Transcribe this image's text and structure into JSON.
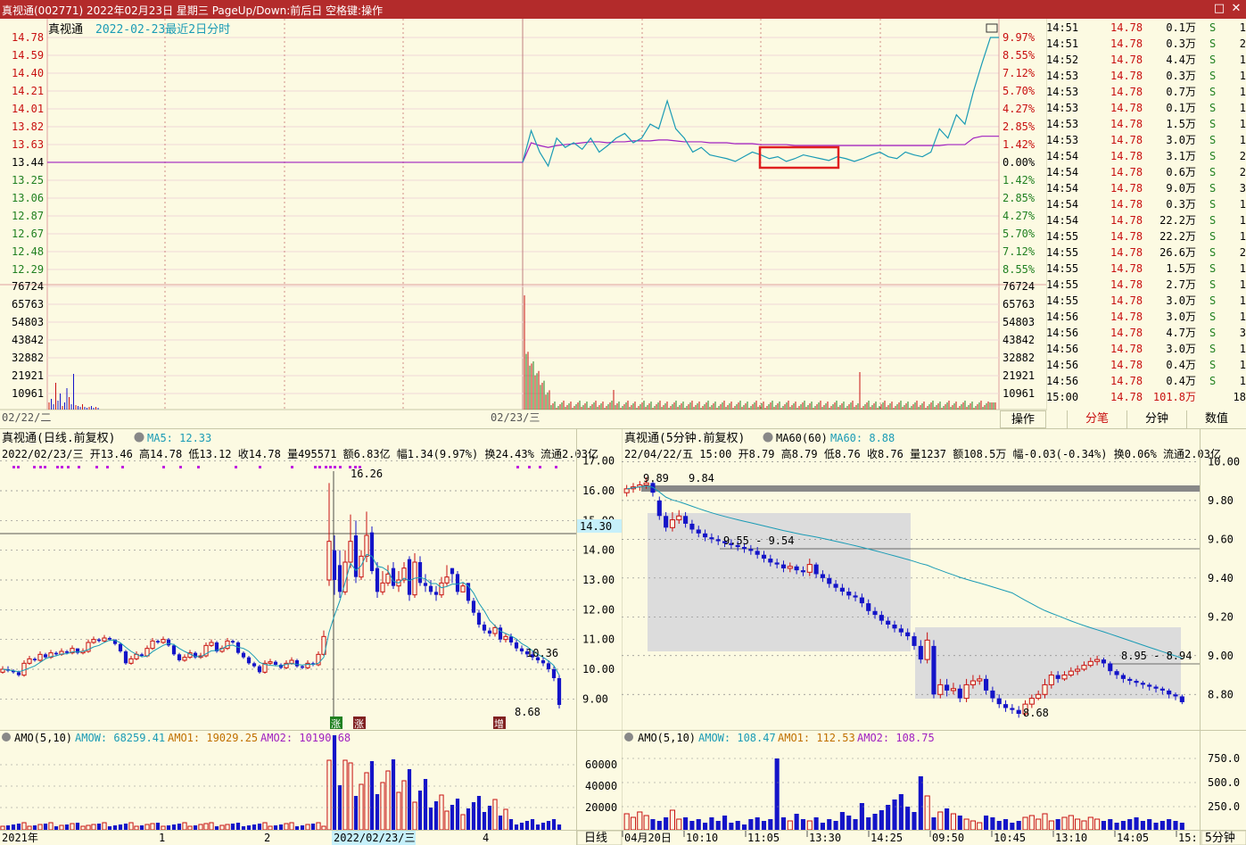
{
  "window": {
    "title": "真视通(002771) 2022年02月23日 星期三 PageUp/Down:前后日 空格键:操作",
    "minimize_icon": "restore-icon",
    "close_icon": "close-icon"
  },
  "colors": {
    "bg": "#fcfae2",
    "grid": "#e8b8b8",
    "up": "#c81010",
    "down": "#1414c8",
    "price_line": "#1a9bb5",
    "avg_line": "#a020c0"
  },
  "intraday": {
    "name": "真视通",
    "date_label": "2022-02-23最近2日分时",
    "price_ticks": [
      "14.78",
      "14.59",
      "14.40",
      "14.21",
      "14.01",
      "13.82",
      "13.63",
      "13.44",
      "13.25",
      "13.06",
      "12.87",
      "12.67",
      "12.48",
      "12.29"
    ],
    "pct_ticks": [
      "9.97%",
      "8.55%",
      "7.12%",
      "5.70%",
      "4.27%",
      "2.85%",
      "1.42%",
      "0.00%",
      "1.42%",
      "2.85%",
      "4.27%",
      "5.70%",
      "7.12%",
      "8.55%"
    ],
    "vol_ticks": [
      "76724",
      "65763",
      "54803",
      "43842",
      "32882",
      "21921",
      "10961"
    ],
    "day_labels": [
      "02/22/二",
      "02/23/三"
    ],
    "prev_close": 13.44,
    "chart_data": {
      "type": "line",
      "series": [
        {
          "values": [
            13.44,
            13.78,
            13.55,
            13.4,
            13.7,
            13.6,
            13.65,
            13.58,
            13.7,
            13.55,
            13.62,
            13.7,
            13.75,
            13.65,
            13.7,
            13.85,
            13.8,
            14.1,
            13.8,
            13.7,
            13.55,
            13.6,
            13.52,
            13.5,
            13.48,
            13.45,
            13.5,
            13.55,
            13.52,
            13.48,
            13.5,
            13.45,
            13.48,
            13.52,
            13.5,
            13.48,
            13.46,
            13.5,
            13.48,
            13.45,
            13.48,
            13.52,
            13.55,
            13.5,
            13.48,
            13.55,
            13.52,
            13.5,
            13.55,
            13.8,
            13.7,
            13.95,
            13.85,
            14.2,
            14.5,
            14.78,
            14.78
          ]
        },
        {
          "values": [
            13.44,
            13.65,
            13.62,
            13.6,
            13.62,
            13.63,
            13.64,
            13.65,
            13.66,
            13.66,
            13.65,
            13.66,
            13.66,
            13.67,
            13.67,
            13.67,
            13.68,
            13.68,
            13.67,
            13.66,
            13.66,
            13.66,
            13.65,
            13.65,
            13.65,
            13.64,
            13.64,
            13.64,
            13.63,
            13.63,
            13.63,
            13.63,
            13.62,
            13.62,
            13.62,
            13.62,
            13.62,
            13.62,
            13.62,
            13.62,
            13.62,
            13.62,
            13.62,
            13.62,
            13.62,
            13.62,
            13.62,
            13.62,
            13.62,
            13.62,
            13.63,
            13.63,
            13.63,
            13.7,
            13.72,
            13.72,
            13.72
          ]
        }
      ]
    }
  },
  "tick_list": {
    "rows": [
      [
        "14:51",
        "14.78",
        "0.1万",
        "S",
        "1"
      ],
      [
        "14:51",
        "14.78",
        "0.3万",
        "S",
        "2"
      ],
      [
        "14:52",
        "14.78",
        "4.4万",
        "S",
        "1"
      ],
      [
        "14:53",
        "14.78",
        "0.3万",
        "S",
        "1"
      ],
      [
        "14:53",
        "14.78",
        "0.7万",
        "S",
        "1"
      ],
      [
        "14:53",
        "14.78",
        "0.1万",
        "S",
        "1"
      ],
      [
        "14:53",
        "14.78",
        "1.5万",
        "S",
        "1"
      ],
      [
        "14:53",
        "14.78",
        "3.0万",
        "S",
        "1"
      ],
      [
        "14:54",
        "14.78",
        "3.1万",
        "S",
        "2"
      ],
      [
        "14:54",
        "14.78",
        "0.6万",
        "S",
        "2"
      ],
      [
        "14:54",
        "14.78",
        "9.0万",
        "S",
        "3"
      ],
      [
        "14:54",
        "14.78",
        "0.3万",
        "S",
        "1"
      ],
      [
        "14:54",
        "14.78",
        "22.2万",
        "S",
        "1"
      ],
      [
        "14:55",
        "14.78",
        "22.2万",
        "S",
        "1"
      ],
      [
        "14:55",
        "14.78",
        "26.6万",
        "S",
        "2"
      ],
      [
        "14:55",
        "14.78",
        "1.5万",
        "S",
        "1"
      ],
      [
        "14:55",
        "14.78",
        "2.7万",
        "S",
        "1"
      ],
      [
        "14:55",
        "14.78",
        "3.0万",
        "S",
        "1"
      ],
      [
        "14:56",
        "14.78",
        "3.0万",
        "S",
        "1"
      ],
      [
        "14:56",
        "14.78",
        "4.7万",
        "S",
        "3"
      ],
      [
        "14:56",
        "14.78",
        "3.0万",
        "S",
        "1"
      ],
      [
        "14:56",
        "14.78",
        "0.4万",
        "S",
        "1"
      ],
      [
        "14:56",
        "14.78",
        "0.4万",
        "S",
        "1"
      ],
      [
        "15:00",
        "14.78",
        "101.8万",
        "",
        "18"
      ]
    ],
    "operate_label": "操作",
    "tabs": [
      "分笔",
      "分钟",
      "数值"
    ]
  },
  "daily": {
    "header": "真视通(日线.前复权)",
    "ma_label": "MA5: 12.33",
    "info": "2022/02/23/三 开13.46 高14.78 低13.12 收14.78 量495571 额6.83亿 幅1.34(9.97%) 换24.43% 流通2.03亿",
    "axis_ticks": [
      "17.00",
      "16.00",
      "15.00",
      "14.00",
      "13.00",
      "12.00",
      "11.00",
      "10.00",
      "9.00"
    ],
    "cursor_value": "14.30",
    "annotations": {
      "high": "16.26",
      "mid": "10.36",
      "low": "8.68"
    },
    "markers": [
      "涨",
      "涨",
      "增"
    ],
    "amo_label": "AMO(5,10)",
    "amo_values": [
      "AMOW: 68259.41",
      "AMO1: 19029.25",
      "AMO2: 10190.68"
    ],
    "amo_ticks": [
      "60000",
      "40000",
      "20000"
    ],
    "x_labels": [
      "2021年",
      "1",
      "2",
      "2022/02/23/三",
      "4"
    ],
    "period_tab": "日线",
    "chart_data": {
      "type": "candlestick",
      "y_axis_range": [
        8.5,
        17.5
      ],
      "close": [
        10.0,
        9.95,
        9.9,
        9.8,
        10.2,
        10.35,
        10.3,
        10.5,
        10.4,
        10.55,
        10.5,
        10.6,
        10.55,
        10.7,
        10.55,
        10.6,
        10.9,
        11.0,
        10.95,
        11.05,
        11.0,
        10.85,
        10.6,
        10.2,
        10.35,
        10.5,
        10.45,
        10.7,
        10.95,
        10.9,
        11.0,
        10.8,
        10.5,
        10.3,
        10.4,
        10.55,
        10.4,
        10.45,
        10.8,
        10.9,
        10.6,
        10.7,
        10.95,
        10.9,
        10.55,
        10.4,
        10.2,
        10.1,
        9.9,
        10.2,
        10.25,
        10.15,
        10.05,
        10.2,
        10.3,
        10.1,
        10.05,
        10.2,
        10.15,
        10.5,
        11.1,
        14.3,
        13.0,
        12.6,
        13.6,
        14.3,
        13.1,
        13.8,
        14.5,
        13.3,
        12.6,
        12.9,
        13.2,
        12.8,
        13.0,
        13.4,
        12.5,
        13.6,
        12.9,
        12.8,
        12.6,
        12.5,
        12.9,
        13.1,
        13.2,
        12.6,
        12.8,
        12.3,
        11.9,
        11.5,
        11.3,
        11.2,
        11.4,
        11.0,
        11.1,
        10.9,
        10.7,
        10.6,
        10.5,
        10.4,
        10.3,
        10.2,
        10.0,
        9.7,
        8.8
      ],
      "open": [
        9.9,
        10.0,
        9.95,
        9.9,
        9.8,
        10.2,
        10.35,
        10.3,
        10.5,
        10.4,
        10.55,
        10.5,
        10.6,
        10.55,
        10.7,
        10.55,
        10.6,
        10.9,
        11.0,
        10.95,
        11.05,
        11.0,
        10.85,
        10.6,
        10.2,
        10.35,
        10.5,
        10.45,
        10.7,
        10.95,
        10.9,
        11.0,
        10.8,
        10.5,
        10.3,
        10.4,
        10.55,
        10.4,
        10.45,
        10.8,
        10.9,
        10.6,
        10.7,
        10.95,
        10.9,
        10.55,
        10.4,
        10.2,
        10.1,
        9.9,
        10.2,
        10.25,
        10.15,
        10.05,
        10.2,
        10.3,
        10.1,
        10.05,
        10.2,
        10.15,
        10.5,
        13.0,
        14.0,
        13.5,
        12.6,
        13.6,
        14.5,
        13.1,
        13.8,
        14.6,
        13.4,
        12.6,
        12.9,
        13.4,
        12.8,
        13.0,
        13.7,
        12.5,
        13.6,
        12.9,
        12.8,
        12.6,
        12.5,
        12.9,
        13.4,
        13.2,
        12.6,
        12.9,
        12.3,
        11.9,
        11.5,
        11.3,
        11.2,
        11.4,
        11.0,
        11.1,
        10.9,
        10.7,
        10.6,
        10.5,
        10.4,
        10.3,
        10.2,
        10.0,
        9.7
      ],
      "high": [
        10.1,
        10.1,
        10.0,
        9.95,
        10.3,
        10.45,
        10.4,
        10.6,
        10.55,
        10.65,
        10.6,
        10.7,
        10.65,
        10.8,
        10.7,
        10.7,
        11.0,
        11.1,
        11.05,
        11.15,
        11.1,
        11.0,
        10.9,
        10.65,
        10.45,
        10.6,
        10.55,
        10.8,
        11.05,
        11.0,
        11.1,
        11.05,
        10.85,
        10.55,
        10.5,
        10.65,
        10.6,
        10.55,
        10.9,
        11.0,
        10.95,
        10.8,
        11.05,
        11.0,
        10.95,
        10.6,
        10.45,
        10.25,
        10.15,
        10.3,
        10.35,
        10.3,
        10.2,
        10.3,
        10.4,
        10.35,
        10.15,
        10.3,
        10.25,
        10.6,
        11.3,
        16.26,
        14.5,
        14.0,
        14.0,
        15.2,
        15.0,
        14.0,
        15.3,
        14.8,
        13.6,
        13.3,
        13.5,
        13.6,
        13.3,
        13.6,
        13.8,
        13.9,
        13.8,
        13.2,
        13.0,
        12.8,
        13.1,
        13.5,
        13.4,
        13.3,
        12.9,
        12.9,
        12.4,
        12.0,
        11.6,
        11.4,
        11.5,
        11.5,
        11.2,
        11.2,
        11.0,
        10.8,
        10.7,
        10.6,
        10.5,
        10.4,
        10.3,
        10.1,
        9.8
      ],
      "low": [
        9.85,
        9.9,
        9.85,
        9.75,
        9.75,
        10.15,
        10.25,
        10.25,
        10.35,
        10.35,
        10.45,
        10.45,
        10.5,
        10.5,
        10.5,
        10.5,
        10.55,
        10.85,
        10.9,
        10.9,
        10.95,
        10.8,
        10.55,
        10.15,
        10.15,
        10.3,
        10.4,
        10.4,
        10.65,
        10.85,
        10.85,
        10.75,
        10.45,
        10.25,
        10.25,
        10.35,
        10.35,
        10.35,
        10.4,
        10.75,
        10.55,
        10.55,
        10.65,
        10.85,
        10.5,
        10.35,
        10.15,
        10.05,
        9.85,
        9.85,
        10.15,
        10.1,
        10.0,
        10.0,
        10.15,
        10.05,
        10.0,
        10.0,
        10.1,
        10.1,
        10.45,
        12.8,
        12.5,
        12.4,
        12.5,
        13.4,
        12.9,
        13.0,
        13.6,
        13.2,
        12.4,
        12.5,
        12.8,
        12.7,
        12.6,
        12.9,
        12.3,
        12.4,
        12.8,
        12.6,
        12.5,
        12.3,
        12.4,
        12.8,
        12.9,
        12.5,
        12.6,
        12.2,
        11.8,
        11.4,
        11.2,
        11.1,
        11.1,
        10.9,
        10.9,
        10.8,
        10.6,
        10.5,
        10.4,
        10.3,
        10.2,
        10.1,
        9.9,
        9.6,
        8.68
      ]
    }
  },
  "min5": {
    "header": "真视通(5分钟.前复权)",
    "ma_label": "MA60(60)",
    "ma_value": "MA60: 8.88",
    "info": "22/04/22/五 15:00 开8.79 高8.79 低8.76 收8.76 量1237 额108.5万 幅-0.03(-0.34%) 换0.06% 流通2.03亿",
    "axis_ticks": [
      "10.00",
      "9.80",
      "9.60",
      "9.40",
      "9.20",
      "9.00",
      "8.80"
    ],
    "annotations": {
      "top": "9.84",
      "band1": "9.55 - 9.54",
      "band2": "8.95 - 8.94",
      "low": "8.68",
      "topleft": "9.89"
    },
    "amo_label": "AMO(5,10)",
    "amo_values": [
      "AMOW: 108.47",
      "AMO1: 112.53",
      "AMO2: 108.75"
    ],
    "amo_ticks": [
      "750.0",
      "500.0",
      "250.0"
    ],
    "x_labels": [
      "04月20日",
      "10:10",
      "11:05",
      "13:30",
      "14:25",
      "09:50",
      "10:45",
      "13:10",
      "14:05",
      "15:"
    ],
    "period_tab": "5分钟",
    "chart_data": {
      "type": "candlestick",
      "y_axis_range": [
        8.7,
        10.08
      ],
      "close": [
        9.86,
        9.87,
        9.88,
        9.89,
        9.84,
        9.72,
        9.66,
        9.7,
        9.72,
        9.68,
        9.65,
        9.63,
        9.61,
        9.6,
        9.59,
        9.58,
        9.57,
        9.56,
        9.55,
        9.54,
        9.52,
        9.5,
        9.48,
        9.47,
        9.45,
        9.46,
        9.44,
        9.43,
        9.47,
        9.42,
        9.4,
        9.37,
        9.35,
        9.33,
        9.31,
        9.3,
        9.27,
        9.23,
        9.21,
        9.18,
        9.16,
        9.14,
        9.12,
        9.1,
        9.05,
        8.98,
        9.08,
        8.8,
        8.85,
        8.82,
        8.83,
        8.78,
        8.85,
        8.87,
        8.88,
        8.82,
        8.78,
        8.75,
        8.73,
        8.72,
        8.7,
        8.75,
        8.78,
        8.8,
        8.85,
        8.9,
        8.88,
        8.9,
        8.92,
        8.93,
        8.95,
        8.97,
        8.98,
        8.96,
        8.92,
        8.9,
        8.88,
        8.87,
        8.86,
        8.85,
        8.84,
        8.83,
        8.82,
        8.8,
        8.79,
        8.76
      ],
      "open": [
        9.84,
        9.86,
        9.87,
        9.88,
        9.89,
        9.8,
        9.72,
        9.66,
        9.7,
        9.72,
        9.68,
        9.65,
        9.63,
        9.61,
        9.6,
        9.59,
        9.58,
        9.57,
        9.56,
        9.55,
        9.54,
        9.52,
        9.5,
        9.48,
        9.47,
        9.45,
        9.46,
        9.44,
        9.43,
        9.47,
        9.42,
        9.4,
        9.37,
        9.35,
        9.33,
        9.31,
        9.3,
        9.27,
        9.23,
        9.21,
        9.18,
        9.16,
        9.14,
        9.12,
        9.1,
        9.05,
        8.98,
        9.05,
        8.8,
        8.85,
        8.82,
        8.83,
        8.78,
        8.85,
        8.87,
        8.88,
        8.82,
        8.78,
        8.75,
        8.73,
        8.72,
        8.7,
        8.75,
        8.78,
        8.8,
        8.85,
        8.9,
        8.88,
        8.9,
        8.92,
        8.93,
        8.95,
        8.97,
        8.98,
        8.96,
        8.92,
        8.9,
        8.88,
        8.87,
        8.86,
        8.85,
        8.84,
        8.83,
        8.82,
        8.8,
        8.79
      ],
      "high": [
        9.88,
        9.89,
        9.9,
        9.92,
        9.9,
        9.82,
        9.74,
        9.74,
        9.75,
        9.74,
        9.7,
        9.67,
        9.65,
        9.63,
        9.62,
        9.61,
        9.6,
        9.59,
        9.58,
        9.57,
        9.56,
        9.54,
        9.52,
        9.5,
        9.49,
        9.48,
        9.47,
        9.46,
        9.5,
        9.48,
        9.44,
        9.42,
        9.39,
        9.37,
        9.35,
        9.33,
        9.32,
        9.29,
        9.25,
        9.23,
        9.2,
        9.18,
        9.16,
        9.14,
        9.12,
        9.08,
        9.12,
        9.08,
        8.88,
        8.88,
        8.86,
        8.85,
        8.88,
        8.9,
        8.9,
        8.9,
        8.84,
        8.8,
        8.77,
        8.75,
        8.74,
        8.77,
        8.8,
        8.82,
        8.88,
        8.92,
        8.92,
        8.92,
        8.94,
        8.95,
        8.97,
        8.99,
        9.0,
        8.99,
        8.97,
        8.93,
        8.91,
        8.89,
        8.88,
        8.87,
        8.86,
        8.85,
        8.84,
        8.83,
        8.81,
        8.8
      ],
      "low": [
        9.82,
        9.84,
        9.85,
        9.86,
        9.82,
        9.7,
        9.64,
        9.64,
        9.68,
        9.66,
        9.63,
        9.61,
        9.59,
        9.58,
        9.57,
        9.56,
        9.55,
        9.54,
        9.53,
        9.52,
        9.5,
        9.48,
        9.46,
        9.45,
        9.43,
        9.43,
        9.42,
        9.41,
        9.41,
        9.4,
        9.38,
        9.35,
        9.33,
        9.31,
        9.29,
        9.28,
        9.25,
        9.21,
        9.19,
        9.16,
        9.14,
        9.12,
        9.1,
        9.08,
        9.03,
        8.96,
        8.96,
        8.78,
        8.78,
        8.79,
        8.8,
        8.76,
        8.76,
        8.83,
        8.85,
        8.8,
        8.76,
        8.73,
        8.71,
        8.7,
        8.68,
        8.69,
        8.73,
        8.77,
        8.78,
        8.83,
        8.86,
        8.87,
        8.89,
        8.9,
        8.92,
        8.94,
        8.95,
        8.94,
        8.9,
        8.88,
        8.86,
        8.85,
        8.84,
        8.83,
        8.82,
        8.81,
        8.8,
        8.78,
        8.77,
        8.75
      ]
    }
  }
}
